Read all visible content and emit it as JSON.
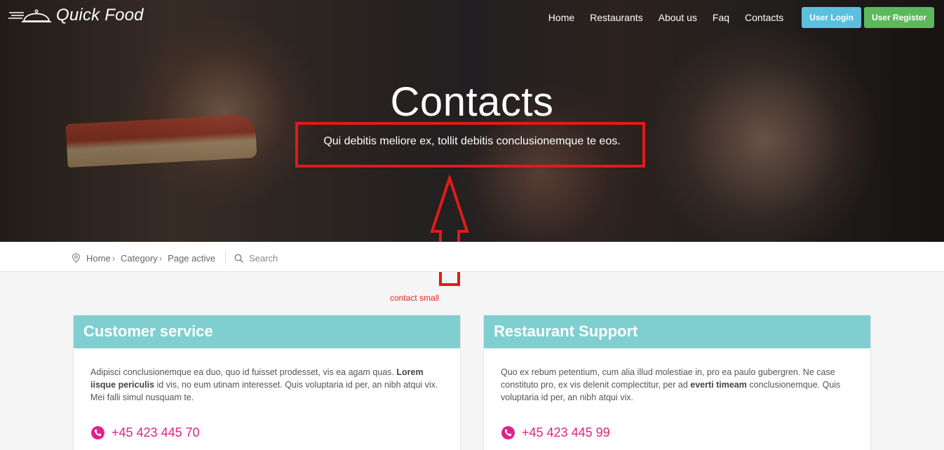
{
  "brand": {
    "name": "Quick Food"
  },
  "nav": {
    "links": [
      "Home",
      "Restaurants",
      "About us",
      "Faq",
      "Contacts"
    ],
    "login": "User Login",
    "register": "User Register"
  },
  "hero": {
    "title": "Contacts",
    "subtitle": "Qui debitis meliore ex, tollit debitis conclusionemque te eos."
  },
  "annotation": {
    "label": "contact small",
    "color": "#e21a1a"
  },
  "breadcrumb": {
    "items": [
      "Home",
      "Category",
      "Page active"
    ],
    "search": "Search"
  },
  "cards": [
    {
      "title": "Customer service",
      "text_before": "Adipisci conclusionemque ea duo, quo id fuisset prodesset, vis ea agam quas. ",
      "text_bold": "Lorem iisque periculis",
      "text_after": " id vis, no eum utinam interesset. Quis voluptaria id per, an nibh atqui vix. Mei falli simul nusquam te.",
      "phone": "+45 423 445 70"
    },
    {
      "title": "Restaurant Support",
      "text_before": "Quo ex rebum petentium, cum alia illud molestiae in, pro ea paulo gubergren. Ne case constituto pro, ex vis delenit complectitur, per ad ",
      "text_bold": "everti timeam",
      "text_after": " conclusionemque. Quis voluptaria id per, an nibh atqui vix.",
      "phone": "+45 423 445 99"
    }
  ],
  "colors": {
    "card_header": "#7fcfd0",
    "phone_accent": "#e0218a",
    "login_btn": "#5bc0de",
    "register_btn": "#5cb85c"
  },
  "icons": [
    "cloche-logo-icon",
    "map-pin-icon",
    "search-icon",
    "phone-icon"
  ]
}
